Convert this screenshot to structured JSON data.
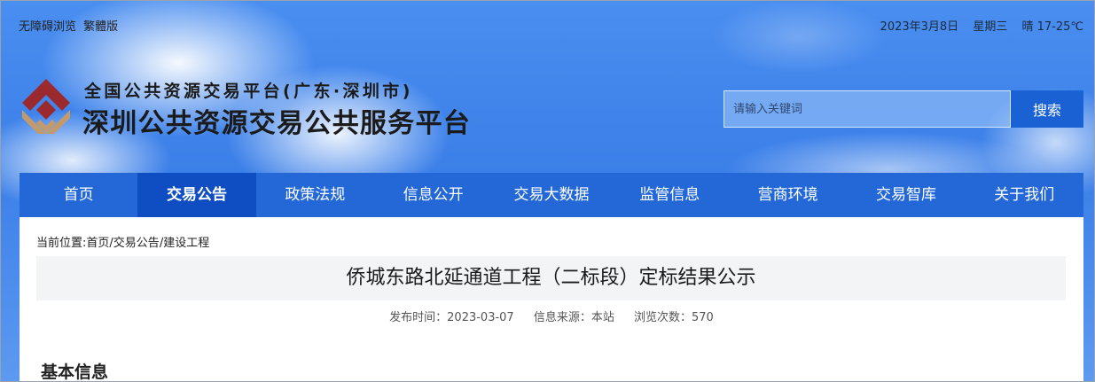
{
  "topbar": {
    "accessibility": "无障碍浏览",
    "traditional": "繁體版",
    "date": "2023年3月8日",
    "weekday": "星期三",
    "weather": "晴 17-25℃"
  },
  "brand": {
    "subtitle": "全国公共资源交易平台(广东·深圳市)",
    "title": "深圳公共资源交易公共服务平台",
    "logo_colors": [
      "#9a2a2e",
      "#c39a6b"
    ]
  },
  "search": {
    "placeholder": "请输入关键词",
    "button": "搜索"
  },
  "nav": {
    "items": [
      {
        "label": "首页"
      },
      {
        "label": "交易公告",
        "active": true
      },
      {
        "label": "政策法规"
      },
      {
        "label": "信息公开"
      },
      {
        "label": "交易大数据"
      },
      {
        "label": "监管信息"
      },
      {
        "label": "营商环境"
      },
      {
        "label": "交易智库"
      },
      {
        "label": "关于我们"
      }
    ]
  },
  "breadcrumb": {
    "prefix": "当前位置:",
    "items": [
      "首页",
      "交易公告",
      "建设工程"
    ]
  },
  "article": {
    "title": "侨城东路北延通道工程（二标段）定标结果公示",
    "publish_time": "发布时间：2023-03-07",
    "source": "信息来源：本站",
    "views": "浏览次数：570",
    "section": "基本信息"
  },
  "colors": {
    "nav_bg": "#2468d8",
    "nav_active": "#0f4ec2",
    "search_button": "#1a62d4"
  }
}
